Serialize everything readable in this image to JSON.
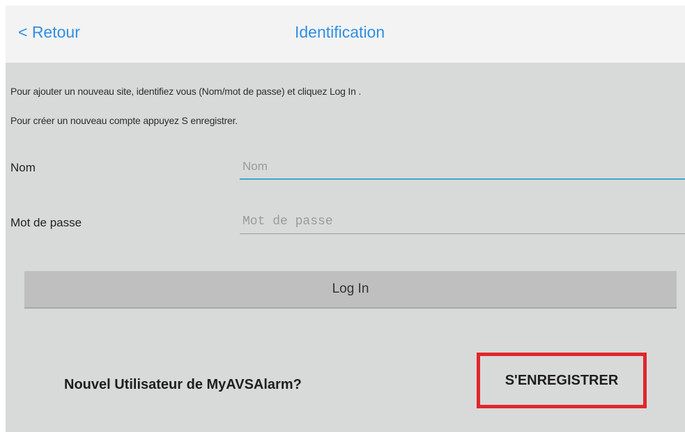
{
  "header": {
    "back_label": "< Retour",
    "title": "Identification"
  },
  "info": {
    "line1": "Pour ajouter un nouveau site, identifiez vous (Nom/mot de passe) et cliquez Log In .",
    "line2": "Pour créer un nouveau compte appuyez S enregistrer."
  },
  "form": {
    "name_label": "Nom",
    "name_placeholder": "Nom",
    "password_label": "Mot de passe",
    "password_placeholder": "Mot de passe",
    "login_label": "Log In"
  },
  "footer": {
    "new_user_text": "Nouvel Utilisateur de MyAVSAlarm?",
    "register_label": "S'ENREGISTRER"
  },
  "colors": {
    "accent": "#2f8fe3",
    "input_focus": "#3ba7c9",
    "highlight_border": "#e0262b",
    "background": "#d8d9d9"
  }
}
